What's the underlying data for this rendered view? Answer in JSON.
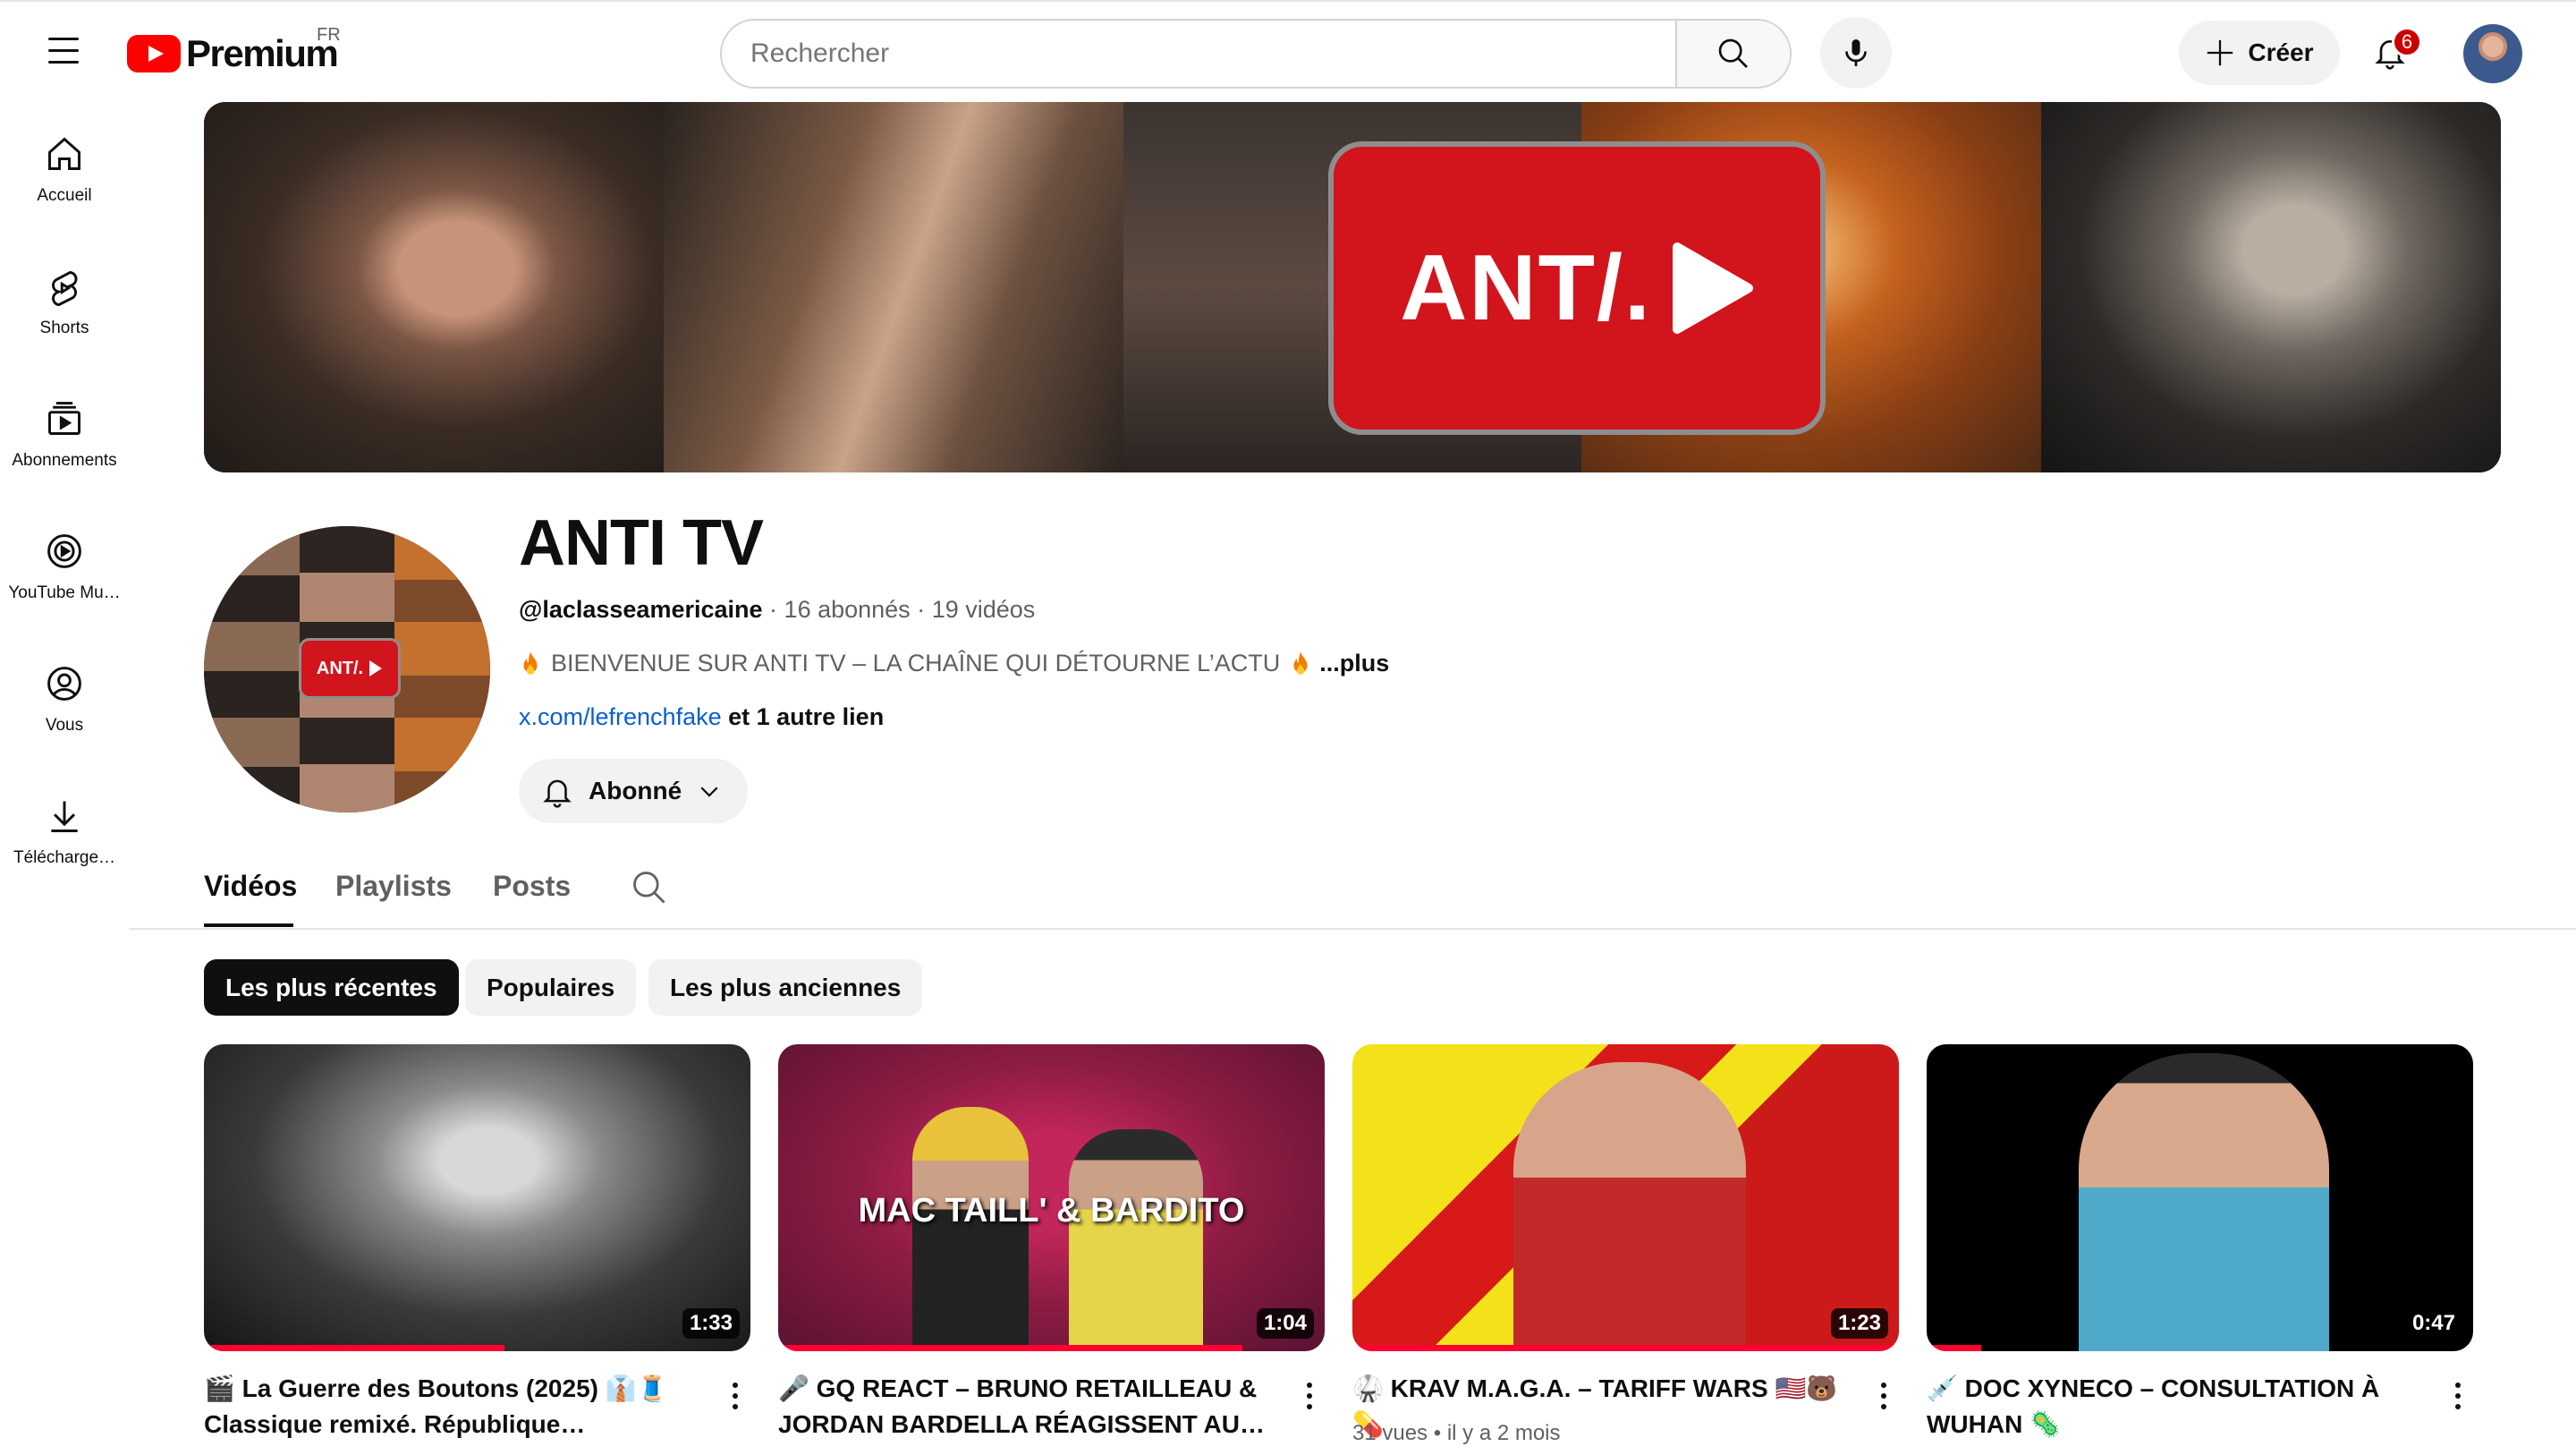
{
  "masthead": {
    "logo_text": "Premium",
    "country_code": "FR",
    "search_placeholder": "Rechercher",
    "create_label": "Créer",
    "notification_count": "6"
  },
  "guide": [
    {
      "label": "Accueil",
      "icon": "home-icon"
    },
    {
      "label": "Shorts",
      "icon": "shorts-icon"
    },
    {
      "label": "Abonnements",
      "icon": "subscriptions-icon"
    },
    {
      "label": "YouTube Mu…",
      "icon": "youtube-music-icon"
    },
    {
      "label": "Vous",
      "icon": "you-icon"
    },
    {
      "label": "Télécharge…",
      "icon": "download-icon"
    }
  ],
  "banner": {
    "logo_text": "ANT/."
  },
  "channel": {
    "avatar_text": "ANT/.",
    "name": "ANTI TV",
    "handle": "@laclasseamericaine",
    "subscribers": "16 abonnés",
    "video_count": "19 vidéos",
    "description": "BIENVENUE SUR ANTI TV – LA CHAÎNE QUI DÉTOURNE L’ACTU",
    "more_label": "...plus",
    "link": "x.com/lefrenchfake",
    "other_links": "et 1 autre lien",
    "subscribe_label": "Abonné"
  },
  "tabs": [
    "Vidéos",
    "Playlists",
    "Posts"
  ],
  "chips": [
    "Les plus récentes",
    "Populaires",
    "Les plus anciennes"
  ],
  "videos": [
    {
      "title": "🎬 La Guerre des Boutons (2025) 👔🧵 Classique remixé. République massacrée,…",
      "duration": "1:33",
      "thumb_text": "",
      "views": "",
      "age": "",
      "progress": 0.55
    },
    {
      "title": "🎤 GQ REACT – BRUNO RETAILLEAU & JORDAN BARDELLA RÉAGISSENT AU RAP…",
      "duration": "1:04",
      "thumb_text": "MAC TAILL' & BARDITO",
      "views": "",
      "age": "",
      "progress": 0.85
    },
    {
      "title": "🥋 KRAV M.A.G.A. – TARIFF WARS 🇺🇸🐻💊",
      "duration": "1:23",
      "thumb_text": "",
      "views": "31 vues",
      "age": "il y a 2 mois",
      "progress": 1.0
    },
    {
      "title": "💉 DOC XYNECO – CONSULTATION À WUHAN 🦠",
      "duration": "0:47",
      "thumb_text": "",
      "views": "",
      "age": "",
      "progress": 0.1
    }
  ],
  "colors": {
    "brand_red": "#ff0000",
    "link_blue": "#065fd4",
    "progress_red": "#ff0033",
    "badge_red": "#cc0000"
  }
}
